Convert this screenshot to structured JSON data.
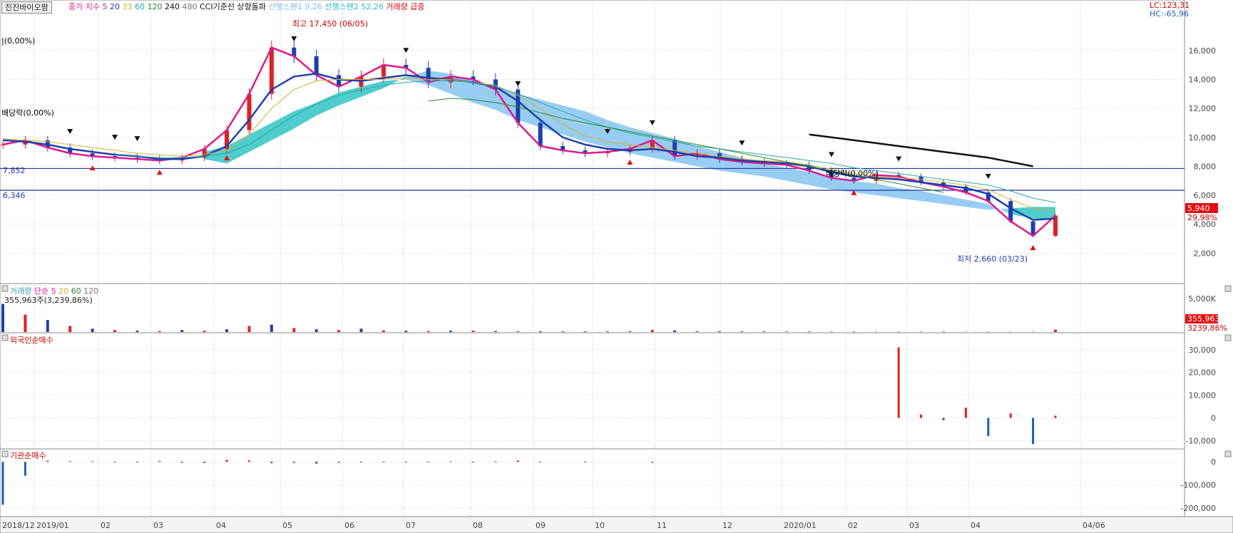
{
  "header": {
    "stock_name": "진진바이오팜",
    "items": [
      {
        "text": "종가 지수 5",
        "color": "#e0198c"
      },
      {
        "text": "20",
        "color": "#1f3fae"
      },
      {
        "text": "33",
        "color": "#d4b030"
      },
      {
        "text": "60",
        "color": "#2aa6a6"
      },
      {
        "text": "120",
        "color": "#2a8a2a"
      },
      {
        "text": "240",
        "color": "#111111"
      },
      {
        "text": "480",
        "color": "#777777"
      },
      {
        "text": "CCI기준선 상향돌파",
        "color": "#111111"
      },
      {
        "text": "선행스팬1 9,26",
        "color": "#7fc0ee"
      },
      {
        "text": "선행스팬2 52,26",
        "color": "#2cbcbc"
      },
      {
        "text": "거래량 급증",
        "color": "#cc0000"
      }
    ],
    "lc": "LC:123,31",
    "hc": "HC:-65,96"
  },
  "annotations": {
    "high": "최고 17,450 (06/05)",
    "low": "최저 2,660 (03/23)",
    "dividend1": "배당락(0,00%)",
    "dividend2": "배당락(0,00%)",
    "dividend3": "배당락(0,00%)",
    "hline1_label": "7,852",
    "hline2_label": "6,346",
    "last_price": "5,940",
    "last_change": "29,98%"
  },
  "volume_panel": {
    "title_items": [
      {
        "text": "거래량",
        "color": "#2aa6a6"
      },
      {
        "text": "단순 5",
        "color": "#e0198c"
      },
      {
        "text": "20",
        "color": "#d4b030"
      },
      {
        "text": "60",
        "color": "#2a8a2a"
      },
      {
        "text": "120",
        "color": "#777777"
      }
    ],
    "value_text": "355,963주(3,239,86%)",
    "last_value": "355,963",
    "last_pct": "3239,86%"
  },
  "foreign_panel": {
    "title": "외국인순매수"
  },
  "institution_panel": {
    "title": "기관순매수"
  },
  "chart_data": {
    "type": "candlestick",
    "price": {
      "ylim": [
        0,
        17450
      ],
      "yticks": [
        "16,000",
        "14,000",
        "12,000",
        "10,000",
        "8,000",
        "6,000",
        "4,000",
        "2,000"
      ],
      "high": 17450,
      "low": 2660,
      "last": 5940,
      "hlines": [
        7852,
        6346
      ],
      "series": [
        {
          "name": "5",
          "color": "#e0198c",
          "values": [
            9500,
            9800,
            9300,
            8900,
            8700,
            8600,
            8500,
            8400,
            8600,
            9200,
            10500,
            13000,
            16200,
            15600,
            14300,
            13500,
            14200,
            15000,
            14800,
            13800,
            14200,
            14000,
            13300,
            11000,
            9400,
            9100,
            8900,
            9000,
            9200,
            9800,
            8700,
            8900,
            8500,
            8300,
            8200,
            8100,
            7700,
            7200,
            7000,
            7400,
            7300,
            6900,
            6600,
            6200,
            5600,
            4200,
            3200,
            4600
          ]
        },
        {
          "name": "20",
          "color": "#1f3fae",
          "values": [
            9800,
            9700,
            9500,
            9200,
            9000,
            8800,
            8700,
            8500,
            8500,
            8700,
            9400,
            11200,
            13300,
            14200,
            14400,
            14000,
            13900,
            14100,
            14300,
            14100,
            14000,
            13800,
            13500,
            12500,
            11200,
            10000,
            9500,
            9200,
            9100,
            9200,
            9000,
            8700,
            8600,
            8400,
            8300,
            8200,
            8000,
            7600,
            7300,
            7200,
            7100,
            6900,
            6700,
            6500,
            6100,
            5100,
            4300,
            4400
          ]
        },
        {
          "name": "33",
          "color": "#d4b030",
          "values": [
            9900,
            9800,
            9700,
            9500,
            9300,
            9100,
            8900,
            8800,
            8700,
            8800,
            9100,
            10200,
            12000,
            13300,
            13900,
            14000,
            14000,
            14000,
            14100,
            14000,
            14000,
            13800,
            13600,
            12900,
            12000,
            10900,
            10100,
            9700,
            9500,
            9300,
            9100,
            8900,
            8700,
            8500,
            8400,
            8300,
            8100,
            7800,
            7500,
            7300,
            7200,
            7100,
            6900,
            6700,
            6400,
            5700,
            5100,
            4900
          ]
        },
        {
          "name": "60",
          "color": "#2aa6a6",
          "values": [
            null,
            null,
            null,
            null,
            null,
            8800,
            8700,
            8600,
            8600,
            8700,
            8900,
            9500,
            10500,
            11500,
            12300,
            12900,
            13300,
            13600,
            13800,
            13900,
            13900,
            13800,
            13500,
            13000,
            12400,
            11800,
            11200,
            10700,
            10300,
            10000,
            9700,
            9400,
            9200,
            9000,
            8800,
            8600,
            8400,
            8200,
            7900,
            7700,
            7500,
            7300,
            7100,
            6900,
            6700,
            6300,
            5800,
            5500
          ]
        },
        {
          "name": "120",
          "color": "#2a8a2a",
          "values": [
            null,
            null,
            null,
            null,
            null,
            null,
            null,
            null,
            null,
            null,
            null,
            null,
            null,
            null,
            null,
            null,
            null,
            null,
            null,
            12500,
            12700,
            12600,
            12400,
            12100,
            11700,
            11300,
            11000,
            10700,
            10400,
            10100,
            9800,
            9500,
            9200,
            8900,
            8600,
            8300,
            8000,
            7700,
            7400,
            7100,
            6800,
            6500,
            6200,
            null,
            null,
            null,
            null,
            null
          ]
        },
        {
          "name": "240",
          "color": "#111111",
          "values": [
            null,
            null,
            null,
            null,
            null,
            null,
            null,
            null,
            null,
            null,
            null,
            null,
            null,
            null,
            null,
            null,
            null,
            null,
            null,
            null,
            null,
            null,
            null,
            null,
            null,
            null,
            null,
            null,
            null,
            null,
            null,
            null,
            null,
            null,
            null,
            null,
            10200,
            10000,
            9800,
            9600,
            9400,
            9200,
            9000,
            8800,
            8600,
            8300,
            8000,
            null
          ]
        }
      ]
    },
    "cloud": {
      "span1": [
        null,
        null,
        null,
        null,
        null,
        null,
        null,
        null,
        null,
        8500,
        8200,
        9000,
        9800,
        10600,
        11500,
        12200,
        12800,
        13400,
        14200,
        14600,
        14400,
        13900,
        13500,
        13000,
        12600,
        12200,
        11800,
        11200,
        10700,
        10300,
        9900,
        9400,
        9000,
        8600,
        8200,
        7900,
        7600,
        7300,
        7000,
        6800,
        6500,
        6300,
        6000,
        5700,
        5400,
        4700,
        4400,
        4300
      ],
      "span2": [
        null,
        null,
        null,
        null,
        null,
        null,
        null,
        null,
        null,
        9000,
        9400,
        10200,
        11000,
        11800,
        12400,
        13100,
        13500,
        13900,
        14000,
        13600,
        13000,
        12400,
        11900,
        11200,
        10700,
        10200,
        9700,
        9300,
        8900,
        8600,
        8300,
        8000,
        7700,
        7500,
        7300,
        7000,
        6700,
        6400,
        6200,
        6000,
        5800,
        5600,
        5400,
        5200,
        5000,
        5100,
        5200,
        5200
      ]
    },
    "volume": {
      "yticks": [
        "5,000K"
      ],
      "values_k": [
        4200,
        2600,
        1800,
        900,
        500,
        300,
        200,
        150,
        300,
        200,
        400,
        900,
        1100,
        600,
        400,
        300,
        500,
        250,
        200,
        150,
        200,
        200,
        150,
        120,
        120,
        110,
        100,
        100,
        100,
        300,
        250,
        120,
        100,
        100,
        80,
        80,
        70,
        60,
        60,
        50,
        50,
        50,
        60,
        50,
        50,
        40,
        40,
        360
      ]
    },
    "foreign_net": {
      "yticks": [
        "30,000",
        "20,000",
        "10,000",
        "0",
        "-10,000"
      ],
      "values": [
        0,
        0,
        0,
        0,
        0,
        0,
        0,
        0,
        0,
        0,
        0,
        0,
        0,
        0,
        0,
        0,
        0,
        0,
        0,
        0,
        0,
        0,
        0,
        0,
        0,
        0,
        0,
        0,
        0,
        0,
        0,
        0,
        0,
        0,
        0,
        0,
        0,
        0,
        0,
        0,
        31000,
        1500,
        -1000,
        4500,
        -8000,
        2000,
        -11500,
        1000
      ]
    },
    "institution_net": {
      "yticks": [
        "0",
        "-100,000",
        "-200,000"
      ],
      "values": [
        -185000,
        -60000,
        5000,
        3000,
        2000,
        -2000,
        -3000,
        4000,
        -4000,
        -5000,
        8000,
        6000,
        -6000,
        -5000,
        -8000,
        -4000,
        -3000,
        -3000,
        -2000,
        -2000,
        2000,
        -2000,
        2000,
        6000,
        -3000,
        0,
        1000,
        0,
        0,
        -4000,
        0,
        0,
        0,
        0,
        0,
        0,
        0,
        0,
        0,
        0,
        0,
        0,
        0,
        0,
        0,
        0,
        0,
        0
      ]
    },
    "x_labels": [
      "2018/12",
      "2019/01",
      "02",
      "03",
      "04",
      "05",
      "06",
      "07",
      "08",
      "09",
      "10",
      "11",
      "12",
      "2020/01",
      "02",
      "03",
      "04",
      "04/06"
    ],
    "xlabel": "",
    "ylabel": ""
  }
}
